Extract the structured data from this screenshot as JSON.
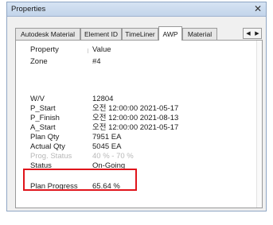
{
  "window": {
    "title": "Properties"
  },
  "tabs": [
    {
      "label": "Autodesk Material"
    },
    {
      "label": "Element ID"
    },
    {
      "label": "TimeLiner"
    },
    {
      "label": "AWP"
    },
    {
      "label": "Material"
    }
  ],
  "active_tab": "AWP",
  "table": {
    "header": {
      "key": "Property",
      "value": "Value"
    },
    "rows": [
      {
        "key": "Zone",
        "value": "#4"
      },
      {
        "key": "W/V",
        "value": "12804"
      },
      {
        "key": "P_Start",
        "value": "오전 12:00:00 2021-05-17"
      },
      {
        "key": "P_Finish",
        "value": "오전 12:00:00 2021-08-13"
      },
      {
        "key": "A_Start",
        "value": "오전 12:00:00 2021-05-17"
      },
      {
        "key": "Plan Qty",
        "value": "7951 EA"
      },
      {
        "key": "Actual Qty",
        "value": "5045 EA"
      },
      {
        "key": "Prog. Status",
        "value": "40 % - 70 %"
      },
      {
        "key": "Status",
        "value": "On-Going"
      },
      {
        "key": "Plan Progress",
        "value": "65.64 %"
      }
    ]
  },
  "highlight_color": "#e0141b"
}
